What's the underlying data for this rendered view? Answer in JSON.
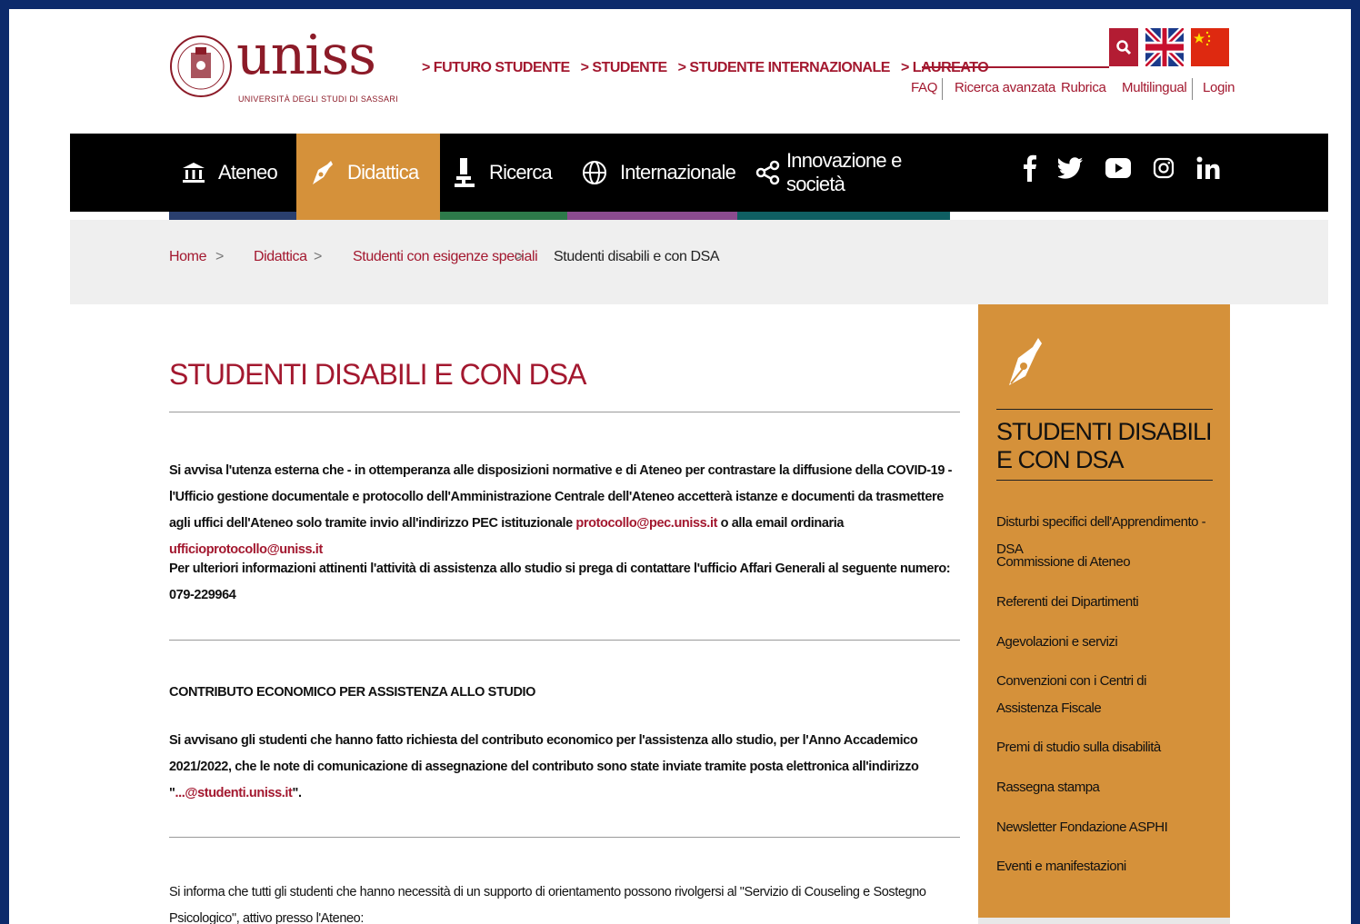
{
  "header": {
    "logo_text": "uniss",
    "logo_sub": "UNIVERSITÀ DEGLI STUDI DI SASSARI",
    "top_links": [
      "> FUTURO STUDENTE",
      "> STUDENTE",
      "> STUDENTE INTERNAZIONALE",
      "> LAUREATO"
    ],
    "search_placeholder": "",
    "utility_links": [
      "FAQ",
      "Ricerca avanzata",
      "Rubrica",
      "Multilingual",
      "Login"
    ]
  },
  "nav": {
    "items": [
      "Ateneo",
      "Didattica",
      "Ricerca",
      "Internazionale",
      "Innovazione e società"
    ],
    "active": "Didattica",
    "stripe_colors": [
      "#2a3f6e",
      "#d5913a",
      "#2d7a4a",
      "#8b4b8f",
      "#0f5f63"
    ],
    "social": [
      "facebook-icon",
      "twitter-icon",
      "youtube-icon",
      "instagram-icon",
      "linkedin-icon"
    ]
  },
  "breadcrumb": {
    "items": [
      "Home",
      "Didattica",
      "Studenti con esigenze speciali"
    ],
    "current": "Studenti disabili e con DSA",
    "separator": ">"
  },
  "main": {
    "title": "STUDENTI DISABILI E CON DSA",
    "p1_a": "Si avvisa l'utenza esterna che - in ottemperanza alle disposizioni normative e di Ateneo per contrastare la diffusione della COVID-19 - l'Ufficio gestione documentale e protocollo dell'Amministrazione Centrale dell'Ateneo accetterà istanze e documenti da trasmettere agli uffici dell'Ateneo solo tramite invio all'indirizzo PEC istituzionale ",
    "p1_link1": "protocollo@pec.uniss.it",
    "p1_b": " o alla email ordinaria ",
    "p1_link2": "ufficioprotocollo@uniss.it",
    "p2": "Per ulteriori informazioni attinenti l'attività di assistenza allo studio si prega di contattare l'ufficio Affari Generali al seguente numero: 079-229964",
    "section_title": "CONTRIBUTO ECONOMICO PER ASSISTENZA ALLO STUDIO",
    "p3_a": "Si avvisano gli studenti che hanno fatto richiesta del contributo economico per l'assistenza allo studio, per l'Anno Accademico 2021/2022, che le note di comunicazione di assegnazione del contributo sono state inviate tramite posta elettronica all'indirizzo \"",
    "p3_link": "...@studenti.uniss.it",
    "p3_b": "\".",
    "p4": "Si informa che tutti gli studenti che hanno necessità di un supporto di orientamento possono rivolgersi al \"Servizio di Couseling e Sostegno Psicologico\", attivo presso l'Ateneo:"
  },
  "sidebar": {
    "title": "STUDENTI DISABILI E CON DSA",
    "links": [
      "Disturbi specifici dell'Apprendimento - DSA",
      "Commissione di Ateneo",
      "Referenti dei Dipartimenti",
      "Agevolazioni e servizi",
      "Convenzioni con i Centri di Assistenza Fiscale",
      "Premi di studio sulla disabilità",
      "Rassegna stampa",
      "Newsletter Fondazione ASPHI",
      "Eventi e manifestazioni"
    ]
  },
  "colors": {
    "accent": "#a3182f",
    "didattica": "#d5913a",
    "frame": "#0c2a6b"
  }
}
